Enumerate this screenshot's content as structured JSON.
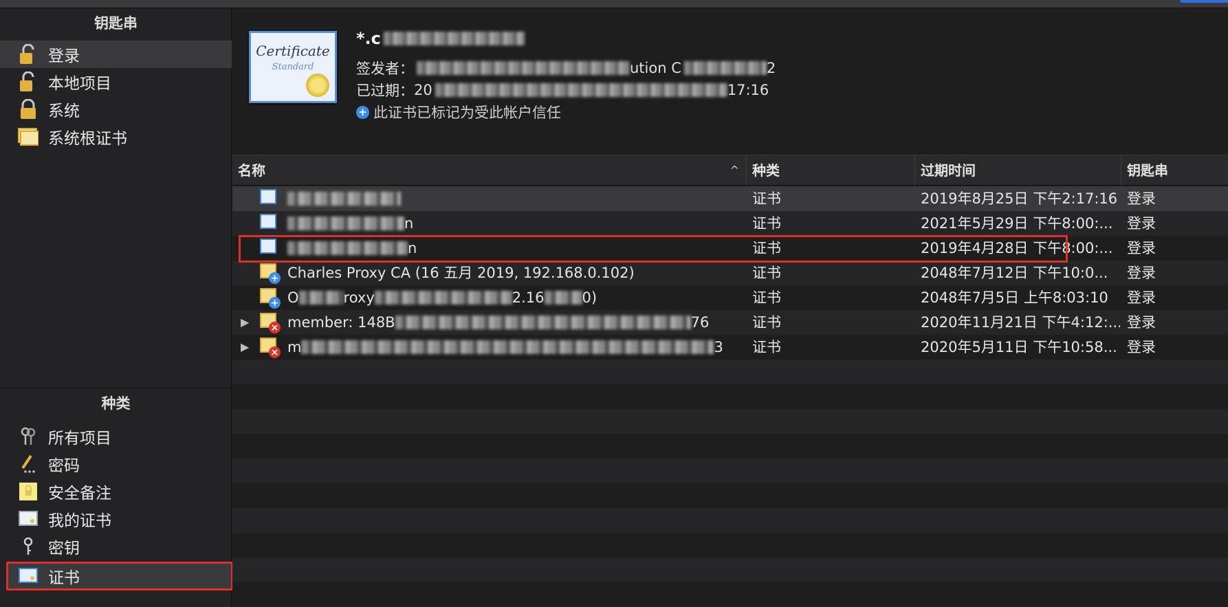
{
  "sidebar": {
    "keychains_header": "钥匙串",
    "keychains": [
      {
        "label": "登录",
        "icon": "unlocked-padlock-icon",
        "selected": true
      },
      {
        "label": "本地项目",
        "icon": "unlocked-padlock-icon",
        "selected": false
      },
      {
        "label": "系统",
        "icon": "locked-padlock-icon",
        "selected": false
      },
      {
        "label": "系统根证书",
        "icon": "certificate-folder-icon",
        "selected": false
      }
    ],
    "category_header": "种类",
    "categories": [
      {
        "label": "所有项目",
        "icon": "keys-icon"
      },
      {
        "label": "密码",
        "icon": "pencil-dots-icon"
      },
      {
        "label": "安全备注",
        "icon": "secure-note-icon"
      },
      {
        "label": "我的证书",
        "icon": "my-certificate-icon"
      },
      {
        "label": "密钥",
        "icon": "key-icon"
      },
      {
        "label": "证书",
        "icon": "certificate-icon",
        "selected": true
      }
    ]
  },
  "detail": {
    "title_prefix": "*.c",
    "issuer_label": "签发者：",
    "issuer_prefix": "",
    "issuer_middle": "ution C",
    "issuer_suffix": "2",
    "expired_label": "已过期：",
    "expired_prefix": "20",
    "expired_suffix": "17:16",
    "trust_text": "此证书已标记为受此帐户信任",
    "cert_text": "Certificate",
    "cert_sub": "Standard"
  },
  "table": {
    "columns": {
      "name": "名称",
      "kind": "种类",
      "expires": "过期时间",
      "keychain": "钥匙串"
    },
    "sort_arrow": "^",
    "rows": [
      {
        "name": "",
        "kind": "证书",
        "expires": "2019年8月25日 下午2:17:16",
        "keychain": "登录",
        "icon": "certificate-icon",
        "badge": "",
        "disclosure": ""
      },
      {
        "name": "",
        "name_suffix": "n",
        "kind": "证书",
        "expires": "2021年5月29日 下午8:00:...",
        "keychain": "登录",
        "icon": "certificate-icon",
        "badge": "",
        "disclosure": ""
      },
      {
        "name": "",
        "name_suffix": "n",
        "kind": "证书",
        "expires": "2019年4月28日 下午8:00:...",
        "keychain": "登录",
        "icon": "certificate-icon",
        "badge": "",
        "disclosure": ""
      },
      {
        "name": "Charles Proxy CA (16 五月 2019, 192.168.0.102)",
        "kind": "证书",
        "expires": "2048年7月12日 下午10:0...",
        "keychain": "登录",
        "icon": "certificate-plus-icon",
        "badge": "+",
        "disclosure": ""
      },
      {
        "name": "O",
        "name_middle": "roxy",
        "name_suffix": "2.16",
        "name_end": "0)",
        "kind": "证书",
        "expires": "2048年7月5日 上午8:03:10",
        "keychain": "登录",
        "icon": "certificate-plus-icon",
        "badge": "+",
        "disclosure": ""
      },
      {
        "name": "member: 148B",
        "name_suffix": "76",
        "kind": "证书",
        "expires": "2020年11月21日 下午4:12:...",
        "keychain": "登录",
        "icon": "certificate-error-icon",
        "badge": "×",
        "disclosure": "▶"
      },
      {
        "name": "m",
        "name_suffix": "3",
        "kind": "证书",
        "expires": "2020年5月11日 下午10:58...",
        "keychain": "登录",
        "icon": "certificate-error-icon",
        "badge": "×",
        "disclosure": "▶"
      }
    ]
  },
  "colors": {
    "highlight": "#e0302a",
    "accent_blue": "#3a8ee6",
    "error_red": "#d9332b"
  }
}
